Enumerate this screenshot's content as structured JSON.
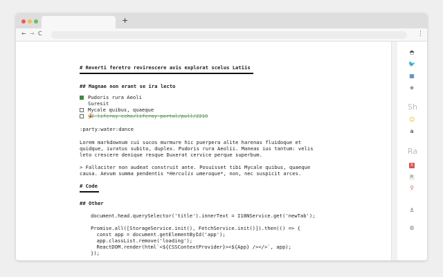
{
  "browser": {
    "new_tab_label": "+",
    "back_icon": "←",
    "forward_icon": "→",
    "reload_icon": "C",
    "menu_icon": "⋮"
  },
  "doc": {
    "title": "# Reverti feretro revirescere avis explorat scelus Latiis",
    "section1": "## Magnae non erant se ira lecto",
    "tasks": [
      {
        "text": "Pudoris rura Aeoli",
        "checked": true
      },
      {
        "text": "Suresit",
        "checked": false,
        "nested": true
      },
      {
        "text": "Mycale quibus, quaeque",
        "checked": false
      },
      {
        "text": "🎉 liferay-echo/liferay-portal/pull/2210",
        "checked": false,
        "strike": true
      }
    ],
    "emoji_line": ":party:water:dance",
    "para1_l1": "Lorem markdownum cui sucos murmure hic puerpera alite harenas fluidoque et",
    "para1_l2": "quidque, iuratus subito, duplex. Pudoris rura Aeolii. Maneas ius tantum: velis",
    "para1_l3": "leto crescere denique resque Duxerat cervice perque superbum.",
    "quote_l1": "> Fallaciter non audeat construit ante. Posuisset tibi Mycale quibus, quaeque",
    "quote_l2a": "causa. Aevum summa pendentis ",
    "quote_l2b": "*Herculis umeroque*",
    "quote_l2c": ", non, nec suspicit arces.",
    "section_code": "# Code",
    "section_other": "## Other",
    "code_lines": [
      "document.head.querySelector('title').innerText = I18NService.get('newTab');",
      "",
      "Promise.all([StorageService.init(), FetchService.init()]).then(() => {",
      "  const app = document.getElementById('app');",
      "  app.classList.remove('loading');",
      "  ReactDOM.render(html`<${CSSContextProvider}><${App} /></>`, app);",
      "});"
    ]
  },
  "sidebar": {
    "items": [
      {
        "name": "github-icon",
        "glyph": "◓",
        "color": "#555555"
      },
      {
        "name": "twitter-icon",
        "glyph": "🐦",
        "color": "#1da1f2"
      },
      {
        "name": "puzzle-icon",
        "glyph": "▦",
        "color": "#2a6fa8"
      },
      {
        "name": "layers-icon",
        "glyph": "◈",
        "color": "#777777"
      },
      {
        "name": "hacker-news-label",
        "text": "Sh"
      },
      {
        "name": "smiley-icon",
        "glyph": "☺",
        "color": "#e6b800"
      },
      {
        "name": "amazon-icon",
        "glyph": "a",
        "color": "#111111"
      },
      {
        "name": "rakuten-label",
        "text": "Ra"
      },
      {
        "name": "s-badge-icon",
        "glyph": "S",
        "color": "#ffffff",
        "bg": "#d9534f"
      },
      {
        "name": "r-badge-icon",
        "glyph": "R",
        "color": "#666666",
        "bg": "#eeeeee"
      },
      {
        "name": "pin-icon",
        "glyph": "⚲",
        "color": "#e06060"
      },
      {
        "name": "anchor-icon",
        "glyph": "⚓",
        "color": "#666666"
      },
      {
        "name": "globe-icon",
        "glyph": "◍",
        "color": "#888888"
      }
    ]
  }
}
